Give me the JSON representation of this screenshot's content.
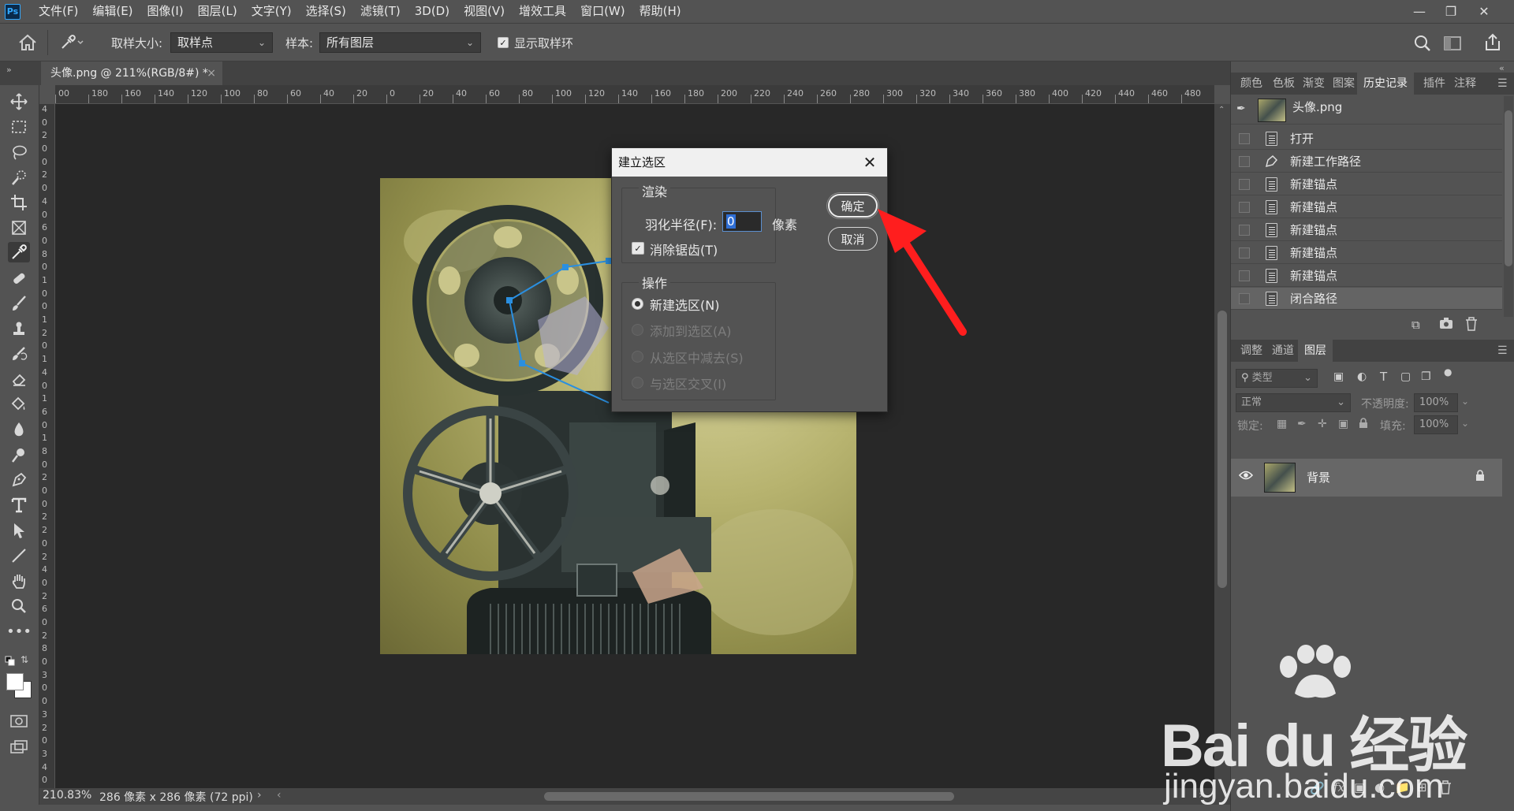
{
  "app": {
    "logo": "Ps",
    "menus": [
      "文件(F)",
      "编辑(E)",
      "图像(I)",
      "图层(L)",
      "文字(Y)",
      "选择(S)",
      "滤镜(T)",
      "3D(D)",
      "视图(V)",
      "增效工具",
      "窗口(W)",
      "帮助(H)"
    ]
  },
  "options_bar": {
    "sample_size_label": "取样大小:",
    "sample_size_value": "取样点",
    "sample_label": "样本:",
    "sample_value": "所有图层",
    "show_ring_label": "显示取样环",
    "show_ring_checked": true
  },
  "document": {
    "tab_title": "头像.png @ 211%(RGB/8#) *",
    "zoom": "210.83%",
    "info": "286 像素 x 286 像素 (72 ppi)"
  },
  "ruler": {
    "top_ticks": [
      "00",
      "180",
      "160",
      "140",
      "120",
      "100",
      "80",
      "60",
      "40",
      "20",
      "0",
      "20",
      "40",
      "60",
      "80",
      "100",
      "120",
      "140",
      "160",
      "180",
      "200",
      "220",
      "240",
      "260",
      "280",
      "300",
      "320",
      "340",
      "360",
      "380",
      "400",
      "420",
      "440",
      "460",
      "480"
    ],
    "left_ticks": [
      "4",
      "0",
      "2",
      "0",
      "0",
      "2",
      "0",
      "4",
      "0",
      "6",
      "0",
      "8",
      "0",
      "1",
      "0",
      "0",
      "1",
      "2",
      "0",
      "1",
      "4",
      "0",
      "1",
      "6",
      "0",
      "1",
      "8",
      "0",
      "2",
      "0",
      "0",
      "2",
      "2",
      "0",
      "2",
      "4",
      "0",
      "2",
      "6",
      "0",
      "2",
      "8",
      "0",
      "3",
      "0",
      "0",
      "3",
      "2",
      "0",
      "3",
      "4",
      "0"
    ]
  },
  "dialog": {
    "title": "建立选区",
    "render_group": "渲染",
    "feather_label": "羽化半径(F):",
    "feather_value": "0",
    "feather_unit": "像素",
    "antialias_label": "消除锯齿(T)",
    "antialias_checked": true,
    "operation_group": "操作",
    "operations": [
      {
        "label": "新建选区(N)",
        "selected": true,
        "enabled": true
      },
      {
        "label": "添加到选区(A)",
        "selected": false,
        "enabled": false
      },
      {
        "label": "从选区中减去(S)",
        "selected": false,
        "enabled": false
      },
      {
        "label": "与选区交叉(I)",
        "selected": false,
        "enabled": false
      }
    ],
    "ok_label": "确定",
    "cancel_label": "取消"
  },
  "panels": {
    "top_tabs": [
      "颜色",
      "色板",
      "渐变",
      "图案",
      "历史记录",
      "插件",
      "注释"
    ],
    "active_top_tab": "历史记录",
    "history_snapshot": "头像.png",
    "history": [
      {
        "label": "打开",
        "icon": "document-icon"
      },
      {
        "label": "新建工作路径",
        "icon": "pen-icon"
      },
      {
        "label": "新建锚点",
        "icon": "document-icon"
      },
      {
        "label": "新建锚点",
        "icon": "document-icon"
      },
      {
        "label": "新建锚点",
        "icon": "document-icon"
      },
      {
        "label": "新建锚点",
        "icon": "document-icon"
      },
      {
        "label": "新建锚点",
        "icon": "document-icon"
      },
      {
        "label": "闭合路径",
        "icon": "document-icon"
      }
    ],
    "layer_tabs": [
      "调整",
      "通道",
      "图层"
    ],
    "active_layer_tab": "图层",
    "filter_placeholder": "类型",
    "blend_mode": "正常",
    "opacity_label": "不透明度:",
    "opacity_value": "100%",
    "lock_label": "锁定:",
    "fill_label": "填充:",
    "fill_value": "100%",
    "layers": [
      {
        "name": "背景",
        "locked": true,
        "visible": true
      }
    ]
  },
  "watermark": {
    "brand": "Bai du 经验",
    "url": "jingyan.baidu.com"
  },
  "colors": {
    "accent": "#31a8ff",
    "path": "#2a8fe0",
    "arrow": "#ff1e1e"
  }
}
